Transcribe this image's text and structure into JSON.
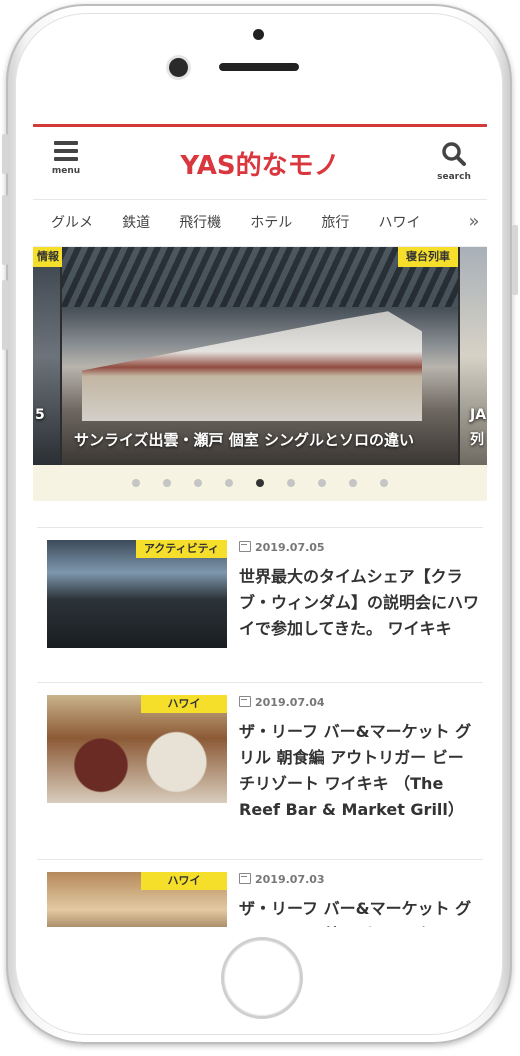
{
  "header": {
    "menu_label": "menu",
    "logo": "YAS的なモノ",
    "search_label": "search",
    "accent": "#d9363e"
  },
  "nav": {
    "items": [
      "グルメ",
      "鉄道",
      "飛行機",
      "ホテル",
      "旅行",
      "ハワイ"
    ],
    "more_icon": "»"
  },
  "slider": {
    "main_badge": "寝台列車",
    "main_title": "サンライズ出雲・瀬戸 個室 シングルとソロの違い",
    "left_badge": "情報",
    "left_text": "5",
    "right_text_1": "JA",
    "right_text_2": "列",
    "dot_count": 9,
    "active_dot": 5
  },
  "articles": [
    {
      "badge": "アクティビティ",
      "date": "2019.07.05",
      "title": "世界最大のタイムシェア【クラブ・ウィンダム】の説明会にハワイで参加してきた。 ワイキキ"
    },
    {
      "badge": "ハワイ",
      "date": "2019.07.04",
      "title": "ザ・リーフ バー&マーケット グリル 朝食編 アウトリガー ビーチリゾート ワイキキ （The Reef Bar & Market Grill）"
    },
    {
      "badge": "ハワイ",
      "date": "2019.07.03",
      "title": "ザ・リーフ バー&マーケット グリル ランチ編 アウトリガー"
    }
  ]
}
